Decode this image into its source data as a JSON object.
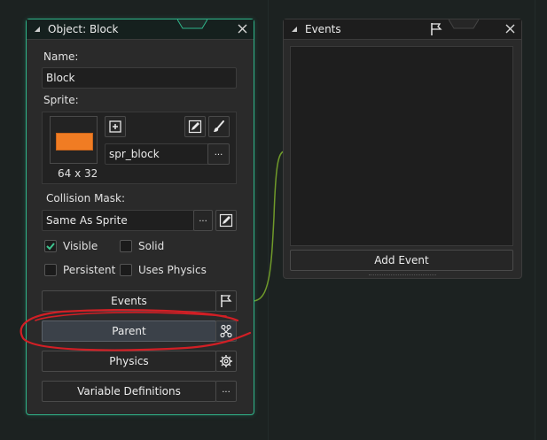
{
  "object_panel": {
    "title": "Object: Block",
    "name_label": "Name:",
    "name_value": "Block",
    "sprite_label": "Sprite:",
    "sprite_size": "64 x 32",
    "sprite_color": "#f07c23",
    "sprite_name": "spr_block",
    "collision_label": "Collision Mask:",
    "collision_value": "Same As Sprite",
    "checkboxes": {
      "visible": {
        "label": "Visible",
        "checked": true
      },
      "solid": {
        "label": "Solid",
        "checked": false
      },
      "persistent": {
        "label": "Persistent",
        "checked": false
      },
      "uses_physics": {
        "label": "Uses Physics",
        "checked": false
      }
    },
    "buttons": {
      "events": "Events",
      "parent": "Parent",
      "physics": "Physics",
      "variable_definitions": "Variable Definitions"
    },
    "more": "···"
  },
  "events_panel": {
    "title": "Events",
    "add_event": "Add Event"
  },
  "colors": {
    "accent": "#2fb58a",
    "annotation": "#d21f25",
    "check": "#3ec48f"
  }
}
